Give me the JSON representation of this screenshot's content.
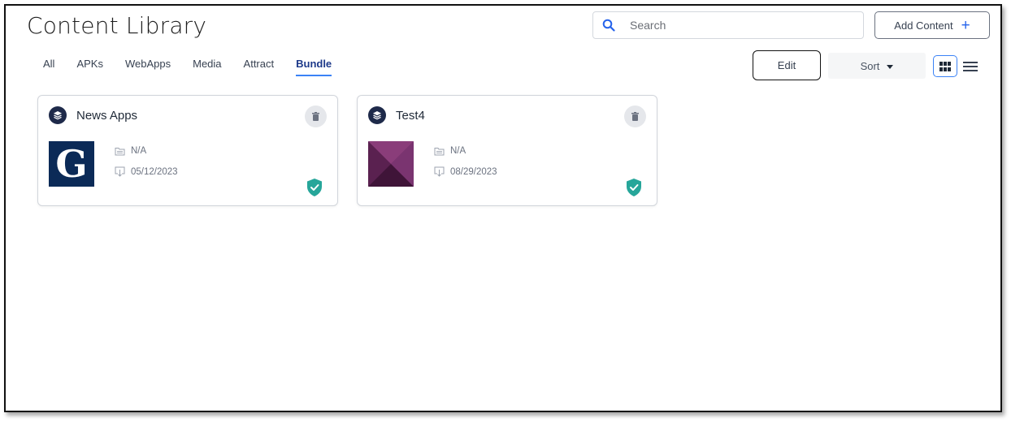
{
  "header": {
    "title": "Content Library",
    "search_placeholder": "Search",
    "add_content_label": "Add Content",
    "add_content_icon": "plus-icon"
  },
  "tabs": [
    {
      "label": "All",
      "active": false
    },
    {
      "label": "APKs",
      "active": false
    },
    {
      "label": "WebApps",
      "active": false
    },
    {
      "label": "Media",
      "active": false
    },
    {
      "label": "Attract",
      "active": false
    },
    {
      "label": "Bundle",
      "active": true
    }
  ],
  "toolbar": {
    "edit_label": "Edit",
    "sort_label": "Sort",
    "view_mode": "grid"
  },
  "cards": [
    {
      "name": "News Apps",
      "icon": "layers-icon",
      "thumbnail": "guardian-logo",
      "thumbnail_text": "G",
      "folder": "N/A",
      "date": "05/12/2023",
      "verified": true
    },
    {
      "name": "Test4",
      "icon": "layers-icon",
      "thumbnail": "purple-pyramid",
      "folder": "N/A",
      "date": "08/29/2023",
      "verified": true
    }
  ],
  "colors": {
    "accent": "#3b82f6",
    "tab_active": "#1e3a8a",
    "badge_bg": "#1e2a4a",
    "verified": "#26a69a",
    "guardian_bg": "#0b2a57",
    "purple_thumb": "#6b2a5e"
  }
}
